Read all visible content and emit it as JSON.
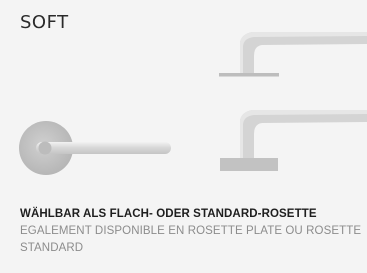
{
  "product": {
    "name": "SOFT"
  },
  "caption": {
    "primary": "WÄHLBAR ALS FLACH- ODER STANDARD-ROSETTE",
    "secondary": "EGALEMENT DISPONIBLE EN ROSETTE PLATE OU ROSETTE STANDARD"
  },
  "colors": {
    "background": "#f4f4f4",
    "metal_light": "#dcdcdc",
    "metal_mid": "#c8c8c8",
    "metal_dark": "#a8a8a8",
    "primary_text": "#1e1e1e",
    "secondary_text": "#8c8c8c"
  },
  "icons": [
    "flat-rosette-side-view",
    "standard-rosette-side-view",
    "handle-front-view"
  ]
}
